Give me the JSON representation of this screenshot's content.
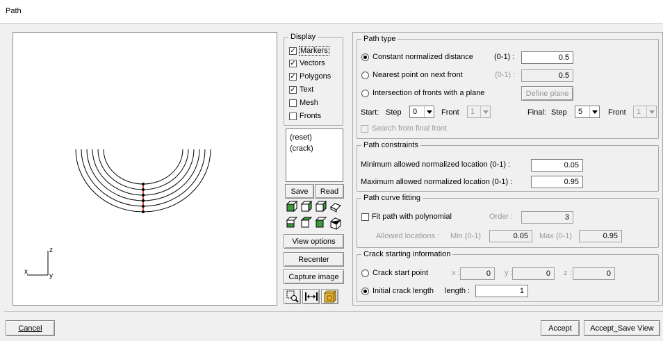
{
  "window": {
    "title": "Path"
  },
  "display": {
    "legend": "Display",
    "options": [
      {
        "label": "Markers",
        "checked": true
      },
      {
        "label": "Vectors",
        "checked": true
      },
      {
        "label": "Polygons",
        "checked": true
      },
      {
        "label": "Text",
        "checked": true
      },
      {
        "label": "Mesh",
        "checked": false
      },
      {
        "label": "Fronts",
        "checked": false
      }
    ]
  },
  "views": {
    "items": [
      "(reset)",
      "(crack)"
    ],
    "save_label": "Save",
    "read_label": "Read"
  },
  "side_buttons": {
    "view_options": "View options",
    "recenter": "Recenter",
    "capture_image": "Capture image"
  },
  "axes": {
    "z": "z",
    "x": "x",
    "y": "y"
  },
  "path_type": {
    "legend": "Path type",
    "constant": {
      "label": "Constant normalized distance",
      "range": "(0-1) :",
      "value": "0.5",
      "selected": true
    },
    "nearest": {
      "label": "Nearest point on next front",
      "range": "(0-1) :",
      "value": "0.5"
    },
    "intersection": {
      "label": "Intersection of fronts with a plane",
      "define_plane": "Define plane"
    },
    "start_label": "Start:",
    "step_label": "Step",
    "front_label": "Front",
    "start_step": "0",
    "start_front": "1",
    "final_label": "Final:",
    "final_step": "5",
    "final_front": "1",
    "search_final": "Search from final front"
  },
  "constraints": {
    "legend": "Path constraints",
    "min_label": "Minimum allowed normalized location  (0-1) :",
    "min_value": "0.05",
    "max_label": "Maximum allowed normalized location (0-1) :",
    "max_value": "0.95"
  },
  "curve": {
    "legend": "Path curve fitting",
    "fit_label": "Fit path with polynomial",
    "order_label": "Order :",
    "order_value": "3",
    "allowed_label": "Allowed locations :",
    "min_label": "Min (0-1)",
    "min_value": "0.05",
    "max_label": "Max (0-1)",
    "max_value": "0.95"
  },
  "crack": {
    "legend": "Crack starting information",
    "start_point": "Crack start point",
    "x_label": "x :",
    "x_value": "0",
    "y_label": "y :",
    "y_value": "0",
    "z_label": "z :",
    "z_value": "0",
    "initial_length": "Initial crack length",
    "length_label": "length :",
    "length_value": "1"
  },
  "footer": {
    "cancel": "Cancel",
    "accept": "Accept",
    "accept_save": "Accept_Save View"
  }
}
